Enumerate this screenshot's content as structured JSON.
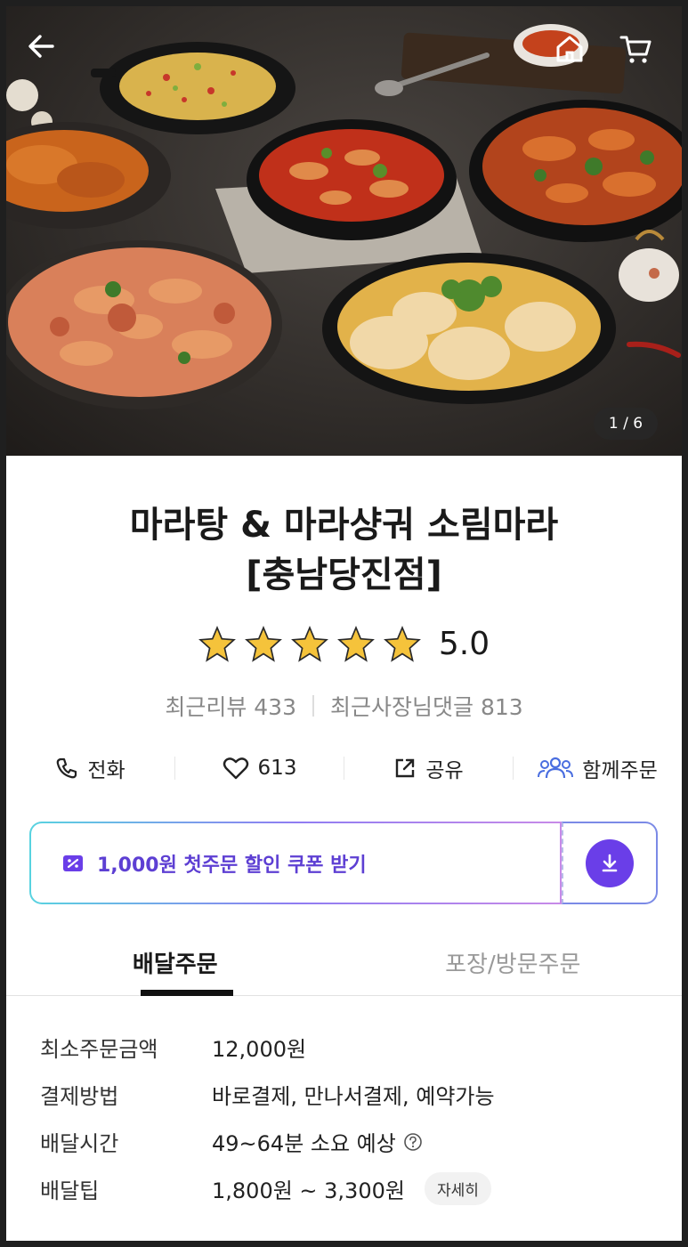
{
  "hero": {
    "counter": "1 / 6"
  },
  "store": {
    "name_line1": "마라탕 & 마라샹궈 소림마라",
    "name_line2": "[충남당진점]",
    "rating": 5.0,
    "rating_text": "5.0",
    "recent_reviews": "최근리뷰 433",
    "owner_replies": "최근사장님댓글 813"
  },
  "actions": {
    "call": "전화",
    "likes": "613",
    "share": "공유",
    "group_order": "함께주문"
  },
  "coupon": {
    "label": "1,000원 첫주문 할인 쿠폰 받기"
  },
  "tabs": [
    {
      "label": "배달주문",
      "active": true
    },
    {
      "label": "포장/방문주문",
      "active": false
    }
  ],
  "info": {
    "min_order": {
      "key": "최소주문금액",
      "value": "12,000원"
    },
    "payment": {
      "key": "결제방법",
      "value": "바로결제, 만나서결제, 예약가능"
    },
    "delivery_time": {
      "key": "배달시간",
      "value": "49~64분 소요 예상"
    },
    "delivery_tip": {
      "key": "배달팁",
      "value": "1,800원 ~ 3,300원",
      "detail": "자세히"
    }
  },
  "colors": {
    "accent": "#6a3ee8",
    "coupon_text": "#5d3fd3",
    "star": "#f5c33b"
  }
}
